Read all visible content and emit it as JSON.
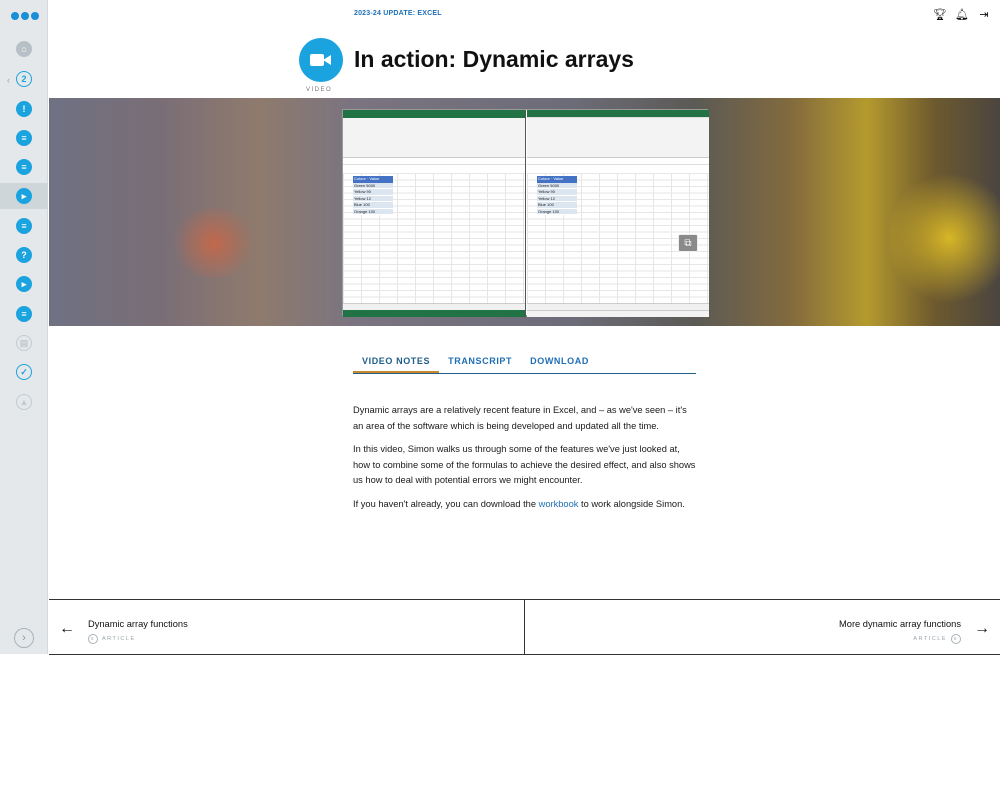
{
  "header": {
    "course_label": "2023-24 UPDATE: EXCEL",
    "page_title": "In action: Dynamic arrays",
    "content_type": "VIDEO"
  },
  "sidebar": {
    "items": [
      {
        "icon": "home-icon"
      },
      {
        "icon": "step-2-icon",
        "label": "2"
      },
      {
        "icon": "lightbulb-icon"
      },
      {
        "icon": "article-icon"
      },
      {
        "icon": "article-icon"
      },
      {
        "icon": "video-icon",
        "active": true
      },
      {
        "icon": "article-icon"
      },
      {
        "icon": "quiz-icon"
      },
      {
        "icon": "video-icon"
      },
      {
        "icon": "article-icon"
      },
      {
        "icon": "document-icon"
      },
      {
        "icon": "check-icon"
      },
      {
        "icon": "trophy-icon"
      }
    ]
  },
  "top_icons": [
    "trophy-icon",
    "bell-icon",
    "logout-icon"
  ],
  "tabs": {
    "video_notes": "VIDEO NOTES",
    "transcript": "TRANSCRIPT",
    "download": "DOWNLOAD"
  },
  "notes": {
    "p1": "Dynamic arrays are a relatively recent feature in Excel, and – as we've seen – it's an area of the software which is being developed and updated all the time.",
    "p2": "In this video, Simon walks us through some of the features we've just looked at, how to combine some of the formulas to achieve the desired effect, and also shows us how to deal with potential errors we might encounter.",
    "p3_before": "If you haven't already, you can download the ",
    "p3_link": "workbook",
    "p3_after": " to work alongside Simon."
  },
  "video_frame": {
    "table_header": [
      "Colour",
      "Value"
    ],
    "rows": [
      [
        "Green",
        "5000"
      ],
      [
        "Yellow",
        "90"
      ],
      [
        "Yellow",
        "12"
      ],
      [
        "Blue",
        "100"
      ],
      [
        "Orange",
        "100"
      ]
    ]
  },
  "footer_nav": {
    "prev": {
      "title": "Dynamic array functions",
      "type": "ARTICLE"
    },
    "next": {
      "title": "More dynamic array functions",
      "type": "ARTICLE"
    }
  }
}
